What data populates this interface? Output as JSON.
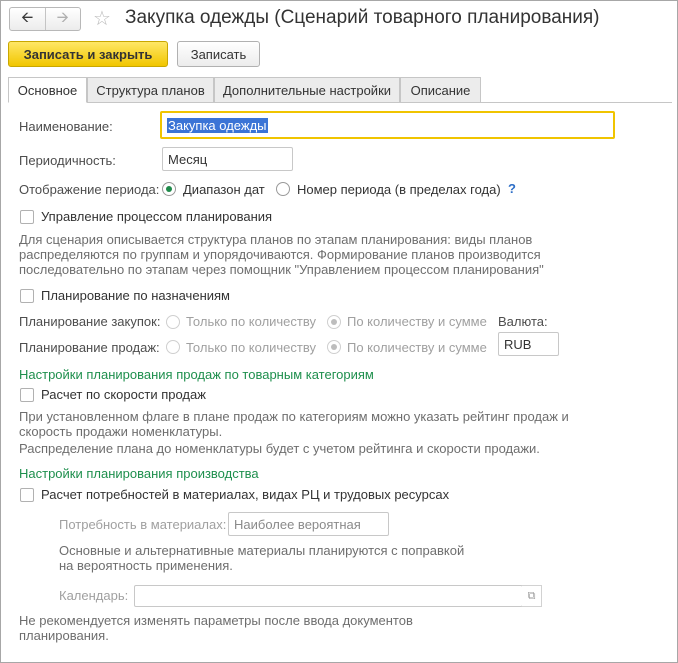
{
  "window": {
    "title": "Закупка одежды (Сценарий товарного планирования)"
  },
  "nav": {
    "back_icon": "arrow-left-icon",
    "forward_icon": "arrow-right-icon",
    "star_icon": "star-icon"
  },
  "toolbar": {
    "save_close_label": "Записать и закрыть",
    "save_label": "Записать"
  },
  "tabs": [
    {
      "label": "Основное",
      "active": true
    },
    {
      "label": "Структура планов"
    },
    {
      "label": "Дополнительные настройки"
    },
    {
      "label": "Описание"
    }
  ],
  "form": {
    "name_label": "Наименование:",
    "name_value": "Закупка одежды",
    "period_label": "Периодичность:",
    "period_value": "Месяц",
    "period_display_label": "Отображение периода:",
    "period_display_options": [
      {
        "label": "Диапазон дат",
        "selected": true
      },
      {
        "label": "Номер периода (в пределах года)",
        "selected": false
      }
    ],
    "help_mark": "?",
    "process_mgmt": {
      "label": "Управление процессом планирования",
      "checked": false
    },
    "process_mgmt_info": "Для сценария описывается структура планов по этапам планирования: виды планов распределяются по группам и упорядочиваются. Формирование планов производится последовательно по этапам через помощник \"Управлением процессом планирования\"",
    "by_assignment": {
      "label": "Планирование по назначениям",
      "checked": false
    },
    "purchase_planning": {
      "label": "Планирование закупок:",
      "options": [
        {
          "label": "Только по количеству",
          "selected": false
        },
        {
          "label": "По количеству и сумме",
          "selected": true
        }
      ]
    },
    "currency_label": "Валюта:",
    "sales_planning": {
      "label": "Планирование продаж:",
      "options": [
        {
          "label": "Только по количеству",
          "selected": false
        },
        {
          "label": "По количеству и сумме",
          "selected": true
        }
      ]
    },
    "currency_value": "RUB",
    "sales_section_title": "Настройки планирования продаж по товарным категориям",
    "sales_speed": {
      "label": "Расчет по скорости продаж",
      "checked": false
    },
    "sales_speed_info_1": "При установленном флаге в плане продаж по категориям можно указать рейтинг продаж и скорость продажи номенклатуры.",
    "sales_speed_info_2": "Распределение плана до номенклатуры будет с учетом рейтинга и скорости продажи.",
    "production_section_title": "Настройки планирования производства",
    "materials_calc": {
      "label": "Расчет потребностей в материалах, видах РЦ и трудовых ресурсах",
      "checked": false
    },
    "materials_need_label": "Потребность в материалах:",
    "materials_need_value": "Наиболее вероятная",
    "materials_info": "Основные и альтернативные материалы планируются с поправкой на вероятность применения.",
    "calendar_label": "Календарь:",
    "calendar_value": "",
    "calendar_icon": "open-window-icon",
    "final_note": "Не рекомендуется изменять параметры после ввода документов планирования."
  },
  "colors": {
    "primary_button": "#f1c600",
    "section_title": "#1e8f4d",
    "radio_selected": "#1f8a4a",
    "help": "#2d6ec7"
  }
}
